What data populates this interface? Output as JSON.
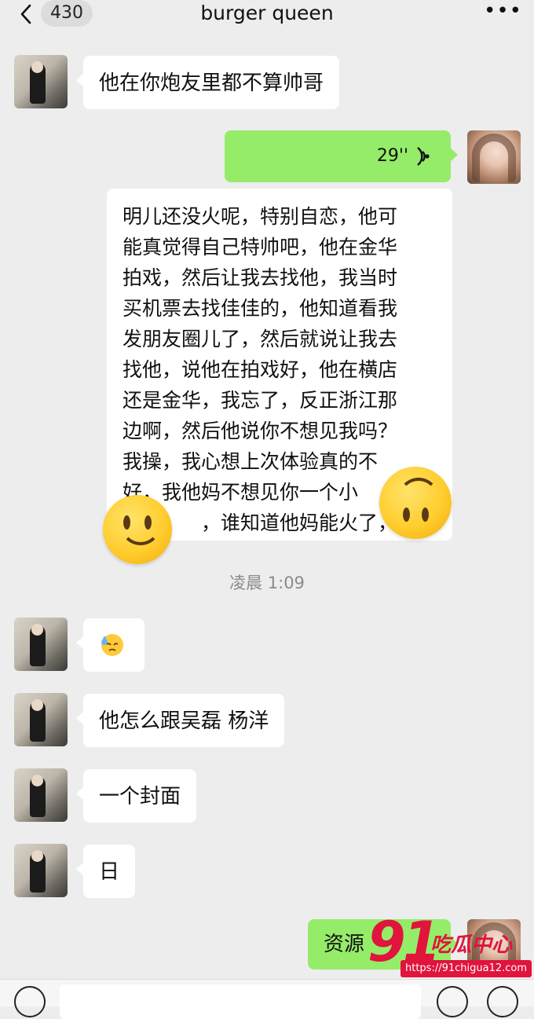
{
  "header": {
    "back_label": "<",
    "unread_count": "430",
    "title": "burger queen",
    "more_label": "•••"
  },
  "messages": {
    "m1": "他在你炮友里都不算帅哥",
    "voice_duration": "29''",
    "transcript_lines": [
      "明儿还没火呢，特别自恋，他可",
      "能真觉得自己特帅吧，他在金华",
      "拍戏，然后让我去找他，我当时",
      "买机票去找佳佳的，他知道看我",
      "发朋友圈儿了，然后就说让我去",
      "找他，说他在拍戏好，他在横店",
      "还是金华，我忘了，反正浙江那",
      "边啊，然后他说你不想见我吗？",
      "我操，我心想上次体验真的不",
      "好，我他妈不想见你一个小",
      "，谁知道他妈能火了，"
    ],
    "timestamp": "凌晨 1:09",
    "m3": "他怎么跟吴磊 杨洋",
    "m4": "一个封面",
    "m5": "日",
    "m6_visible": "资源"
  },
  "sticker_emojis": [
    "slightly-smiling-face",
    "upside-down-face"
  ],
  "watermark": {
    "number": "91",
    "brand": "吃瓜中心",
    "url": "https://91chigua12.com"
  },
  "colors": {
    "background": "#ededed",
    "outgoing_bubble": "#95ec69",
    "incoming_bubble": "#ffffff",
    "watermark_red": "#e0143c"
  }
}
